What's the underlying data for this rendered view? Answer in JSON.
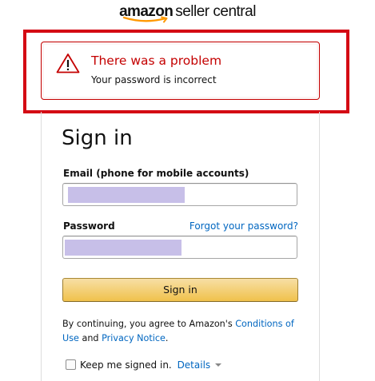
{
  "header": {
    "logo_primary": "amazon",
    "logo_secondary": "seller central"
  },
  "alert": {
    "title": "There was a problem",
    "message": "Your password is incorrect",
    "icon": "warning-icon",
    "color": "#c40000"
  },
  "highlight": {
    "color": "#d40a14"
  },
  "signin": {
    "heading": "Sign in",
    "email_label": "Email (phone for mobile accounts)",
    "email_value": "",
    "password_label": "Password",
    "password_value": "",
    "forgot_link": "Forgot your password?",
    "submit_label": "Sign in",
    "legal_prefix": "By continuing, you agree to Amazon's ",
    "conditions_link": "Conditions of Use",
    "legal_and": " and ",
    "privacy_link": "Privacy Notice",
    "legal_suffix": ".",
    "keep_signed_in_label": "Keep me signed in.",
    "keep_signed_in_checked": false,
    "details_link": "Details"
  },
  "colors": {
    "link": "#0066c0",
    "button_top": "#f7dfa5",
    "button_bottom": "#f0c14b",
    "redaction": "#c7bfe8",
    "smile": "#ff9900"
  }
}
